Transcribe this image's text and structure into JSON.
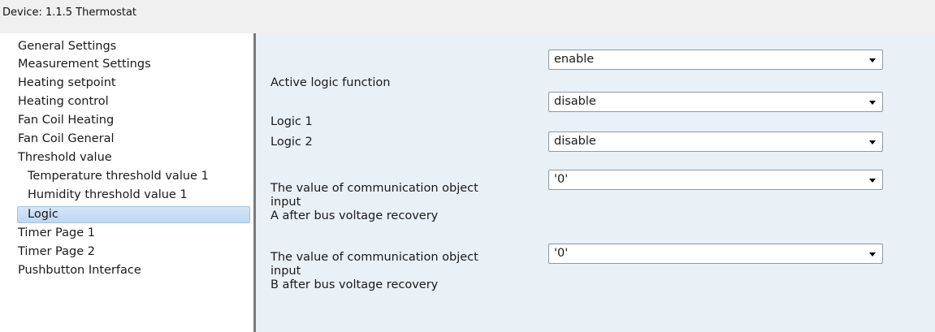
{
  "window": {
    "title": "Device: 1.1.5  Thermostat"
  },
  "sidebar": {
    "items": [
      {
        "label": "General Settings"
      },
      {
        "label": "Measurement Settings"
      },
      {
        "label": "Heating setpoint"
      },
      {
        "label": "Heating control"
      },
      {
        "label": "Fan Coil Heating"
      },
      {
        "label": "Fan Coil General"
      },
      {
        "label": "Threshold value"
      },
      {
        "label": "Temperature threshold value 1"
      },
      {
        "label": "Humidity threshold value 1"
      },
      {
        "label": "Logic",
        "selected": true
      },
      {
        "label": "Timer Page 1"
      },
      {
        "label": "Timer Page 2"
      },
      {
        "label": "Pushbutton Interface"
      }
    ]
  },
  "params": [
    {
      "label": "Active logic function",
      "value": "enable"
    },
    {
      "label": "Logic 1",
      "value": "disable"
    },
    {
      "label": "Logic 2",
      "value": "disable"
    },
    {
      "label_lines": [
        "The value of communication object",
        "input",
        "A after bus voltage recovery"
      ],
      "value": "'0'"
    },
    {
      "label_lines": [
        "The value of communication object",
        "input",
        "B after bus voltage recovery"
      ],
      "value": "'0'"
    }
  ],
  "colors": {
    "content_bg": "#e9f0f6",
    "selection_bg": "#c9dff5",
    "splitter": "#7a7a7a"
  }
}
